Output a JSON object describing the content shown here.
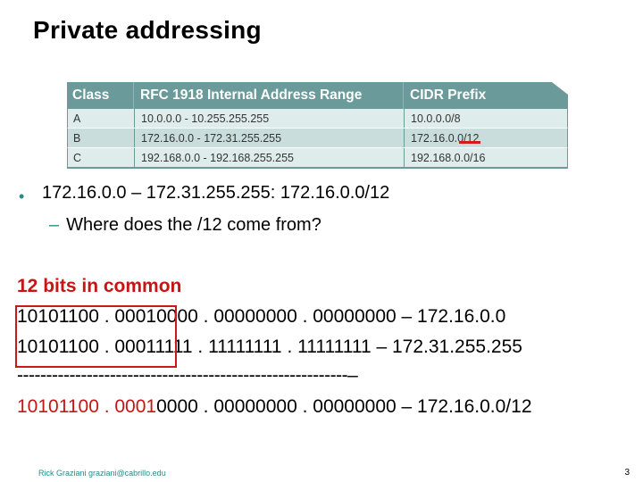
{
  "slide": {
    "title": "Private addressing",
    "table": {
      "headers": [
        "Class",
        "RFC 1918 Internal Address Range",
        "CIDR Prefix"
      ],
      "rows": [
        [
          "A",
          "10.0.0.0 - 10.255.255.255",
          "10.0.0.0/8"
        ],
        [
          "B",
          "172.16.0.0 - 172.31.255.255",
          "172.16.0.0/12"
        ],
        [
          "C",
          "192.168.0.0 - 192.168.255.255",
          "192.168.0.0/16"
        ]
      ]
    },
    "bullet": "172.16.0.0 – 172.31.255.255: 172.16.0.0/12",
    "sub_bullet_dash": "–",
    "sub_bullet": "Where does the /12 come from?",
    "bits_heading": "12 bits in common",
    "binary_line1": "10101100 . 00010000 . 00000000 . 00000000 – 172.16.0.0",
    "binary_line2": "10101100 . 00011111 . 11111111 . 11111111 – 172.31.255.255",
    "dash_line": "---------------------------------------------------------–",
    "result_common": "10101100 . 0001",
    "result_rest": "0000 . 00000000 . 00000000 – 172.16.0.0/12",
    "footer": "Rick Graziani  graziani@cabrillo.edu",
    "page_number": "3",
    "colors": {
      "accent_teal": "#6a9a9a",
      "highlight_red": "#c81414"
    }
  }
}
